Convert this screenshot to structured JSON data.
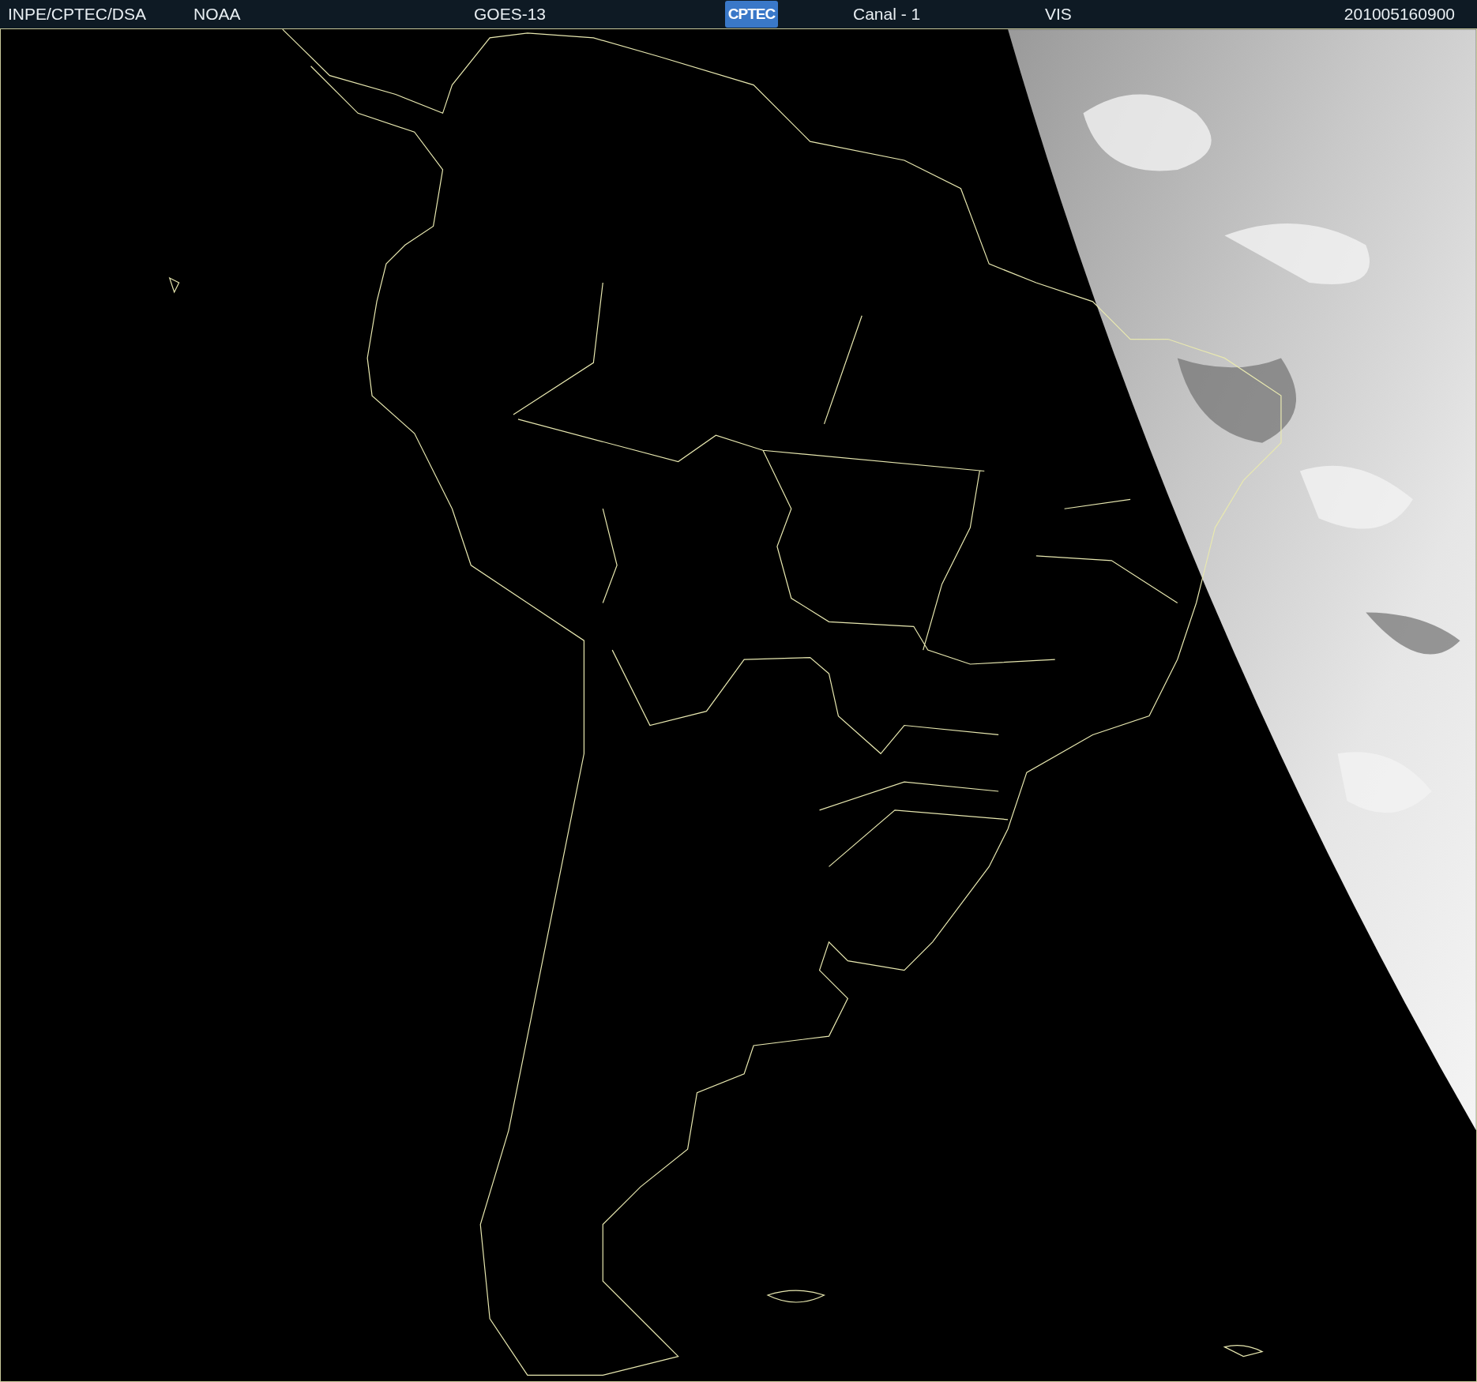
{
  "header": {
    "items": [
      {
        "kind": "text",
        "text": "INPE/CPTEC/DSA"
      },
      {
        "kind": "text",
        "text": "NOAA"
      },
      {
        "kind": "text",
        "text": "GOES-13"
      },
      {
        "kind": "logo",
        "text": "CPTEC"
      },
      {
        "kind": "text",
        "text": "Canal - 1"
      },
      {
        "kind": "text",
        "text": "VIS"
      },
      {
        "kind": "timestamp",
        "text": "201005160900"
      }
    ]
  }
}
